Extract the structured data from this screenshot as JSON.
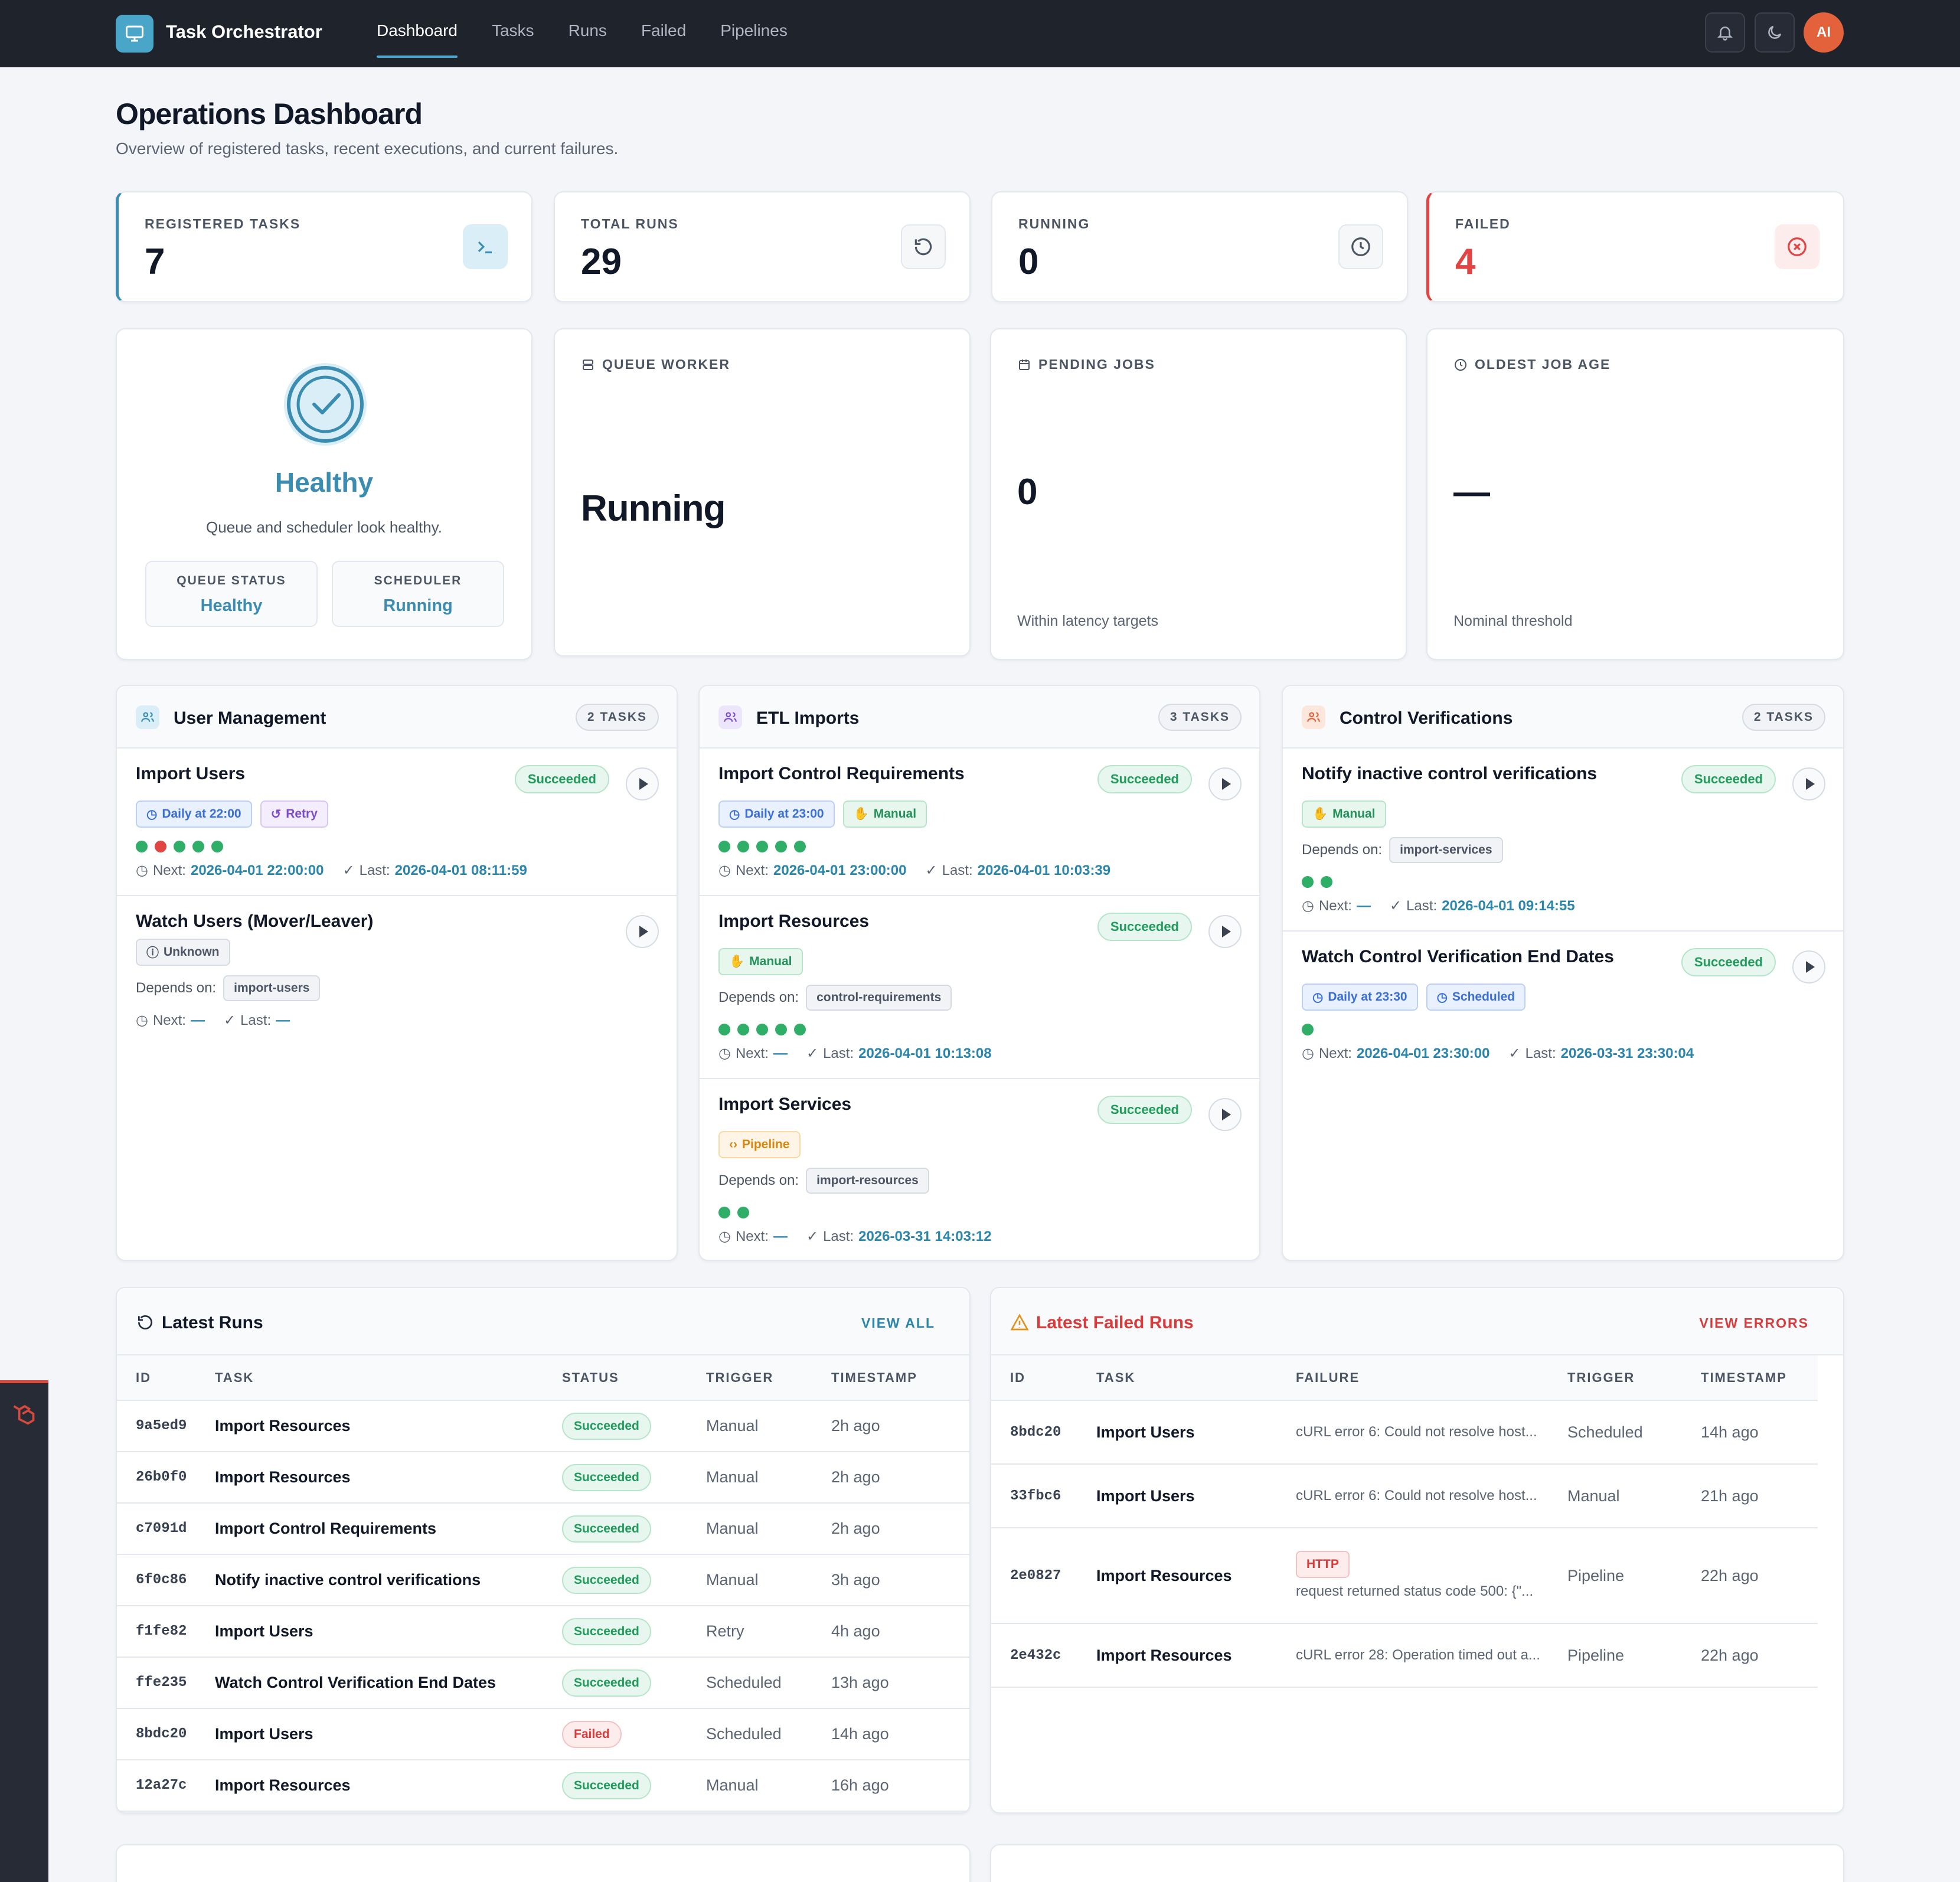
{
  "app": {
    "title": "Task Orchestrator",
    "avatar": "AI"
  },
  "nav": [
    "Dashboard",
    "Tasks",
    "Runs",
    "Failed",
    "Pipelines"
  ],
  "page": {
    "title": "Operations Dashboard",
    "subtitle": "Overview of registered tasks, recent executions, and current failures."
  },
  "stats": [
    {
      "label": "REGISTERED TASKS",
      "value": "7",
      "icon": "terminal-icon"
    },
    {
      "label": "TOTAL RUNS",
      "value": "29",
      "icon": "history-icon"
    },
    {
      "label": "RUNNING",
      "value": "0",
      "icon": "clock-icon"
    },
    {
      "label": "FAILED",
      "value": "4",
      "icon": "x-circle-icon"
    }
  ],
  "health": {
    "status": "Healthy",
    "message": "Queue and scheduler look healthy.",
    "queue_label": "QUEUE STATUS",
    "queue_value": "Healthy",
    "scheduler_label": "SCHEDULER",
    "scheduler_value": "Running"
  },
  "queue_worker": {
    "label": "QUEUE WORKER",
    "value": "Running"
  },
  "pending_jobs": {
    "label": "PENDING JOBS",
    "value": "0",
    "foot": "Within latency targets"
  },
  "oldest_job": {
    "label": "OLDEST JOB AGE",
    "value": "—",
    "foot": "Nominal threshold"
  },
  "labels": {
    "depends": "Depends on:",
    "next": "Next:",
    "last": "Last:"
  },
  "groups": [
    {
      "title": "User Management",
      "count": "2 TASKS",
      "tasks": [
        {
          "name": "Import Users",
          "status": "Succeeded",
          "tags": [
            {
              "text": "Daily at 22:00",
              "kind": "blue",
              "icon": "clock-icon"
            },
            {
              "text": "Retry",
              "kind": "purple",
              "icon": "retry-icon"
            }
          ],
          "dots": [
            "ok",
            "bad",
            "ok",
            "ok",
            "ok"
          ],
          "next": "2026-04-01 22:00:00",
          "last": "2026-04-01 08:11:59"
        },
        {
          "name": "Watch Users (Mover/Leaver)",
          "tags": [
            {
              "text": "Unknown",
              "kind": "gray",
              "icon": "info-icon"
            }
          ],
          "depends": "import-users",
          "next": "—",
          "last": "—"
        }
      ]
    },
    {
      "title": "ETL Imports",
      "count": "3 TASKS",
      "tasks": [
        {
          "name": "Import Control Requirements",
          "status": "Succeeded",
          "tags": [
            {
              "text": "Daily at 23:00",
              "kind": "blue",
              "icon": "clock-icon"
            },
            {
              "text": "Manual",
              "kind": "green",
              "icon": "hand-icon"
            }
          ],
          "dots": [
            "ok",
            "ok",
            "ok",
            "ok",
            "ok"
          ],
          "next": "2026-04-01 23:00:00",
          "last": "2026-04-01 10:03:39"
        },
        {
          "name": "Import Resources",
          "status": "Succeeded",
          "tags": [
            {
              "text": "Manual",
              "kind": "green",
              "icon": "hand-icon"
            }
          ],
          "depends": "control-requirements",
          "dots": [
            "ok",
            "ok",
            "ok",
            "ok",
            "ok"
          ],
          "next": "—",
          "last": "2026-04-01 10:13:08"
        },
        {
          "name": "Import Services",
          "status": "Succeeded",
          "tags": [
            {
              "text": "Pipeline",
              "kind": "orange",
              "icon": "code-icon"
            }
          ],
          "depends": "import-resources",
          "dots": [
            "ok",
            "ok"
          ],
          "next": "—",
          "last": "2026-03-31 14:03:12"
        }
      ]
    },
    {
      "title": "Control Verifications",
      "count": "2 TASKS",
      "tasks": [
        {
          "name": "Notify inactive control verifications",
          "status": "Succeeded",
          "tags": [
            {
              "text": "Manual",
              "kind": "green",
              "icon": "hand-icon"
            }
          ],
          "depends": "import-services",
          "dots": [
            "ok",
            "ok"
          ],
          "next": "—",
          "last": "2026-04-01 09:14:55"
        },
        {
          "name": "Watch Control Verification End Dates",
          "status": "Succeeded",
          "tags": [
            {
              "text": "Daily at 23:30",
              "kind": "blue",
              "icon": "clock-icon"
            },
            {
              "text": "Scheduled",
              "kind": "blue",
              "icon": "clock-icon"
            }
          ],
          "dots": [
            "ok"
          ],
          "next": "2026-04-01 23:30:00",
          "last": "2026-03-31 23:30:04"
        }
      ]
    }
  ],
  "latest_runs": {
    "title": "Latest Runs",
    "link": "VIEW ALL",
    "columns": [
      "ID",
      "TASK",
      "STATUS",
      "TRIGGER",
      "TIMESTAMP"
    ],
    "rows": [
      [
        "9a5ed9",
        "Import Resources",
        "Succeeded",
        "Manual",
        "2h ago"
      ],
      [
        "26b0f0",
        "Import Resources",
        "Succeeded",
        "Manual",
        "2h ago"
      ],
      [
        "c7091d",
        "Import Control Requirements",
        "Succeeded",
        "Manual",
        "2h ago"
      ],
      [
        "6f0c86",
        "Notify inactive control verifications",
        "Succeeded",
        "Manual",
        "3h ago"
      ],
      [
        "f1fe82",
        "Import Users",
        "Succeeded",
        "Retry",
        "4h ago"
      ],
      [
        "ffe235",
        "Watch Control Verification End Dates",
        "Succeeded",
        "Scheduled",
        "13h ago"
      ],
      [
        "8bdc20",
        "Import Users",
        "Failed",
        "Scheduled",
        "14h ago"
      ],
      [
        "12a27c",
        "Import Resources",
        "Succeeded",
        "Manual",
        "16h ago"
      ]
    ]
  },
  "failed_runs": {
    "title": "Latest Failed Runs",
    "link": "VIEW ERRORS",
    "columns": [
      "ID",
      "TASK",
      "FAILURE",
      "TRIGGER",
      "TIMESTAMP"
    ],
    "rows": [
      {
        "id": "8bdc20",
        "task": "Import Users",
        "badge": "",
        "failure": "cURL error 6: Could not resolve host...",
        "trigger": "Scheduled",
        "time": "14h ago"
      },
      {
        "id": "33fbc6",
        "task": "Import Users",
        "badge": "",
        "failure": "cURL error 6: Could not resolve host...",
        "trigger": "Manual",
        "time": "21h ago"
      },
      {
        "id": "2e0827",
        "task": "Import Resources",
        "badge": "HTTP",
        "failure": "request returned status code 500: {\"...",
        "trigger": "Pipeline",
        "time": "22h ago"
      },
      {
        "id": "2e432c",
        "task": "Import Resources",
        "badge": "",
        "failure": "cURL error 28: Operation timed out a...",
        "trigger": "Pipeline",
        "time": "22h ago"
      }
    ]
  },
  "colors": {
    "accent": "#4aa6c9",
    "success": "#2fae68",
    "danger": "#e24444",
    "topbar": "#1f232c"
  }
}
